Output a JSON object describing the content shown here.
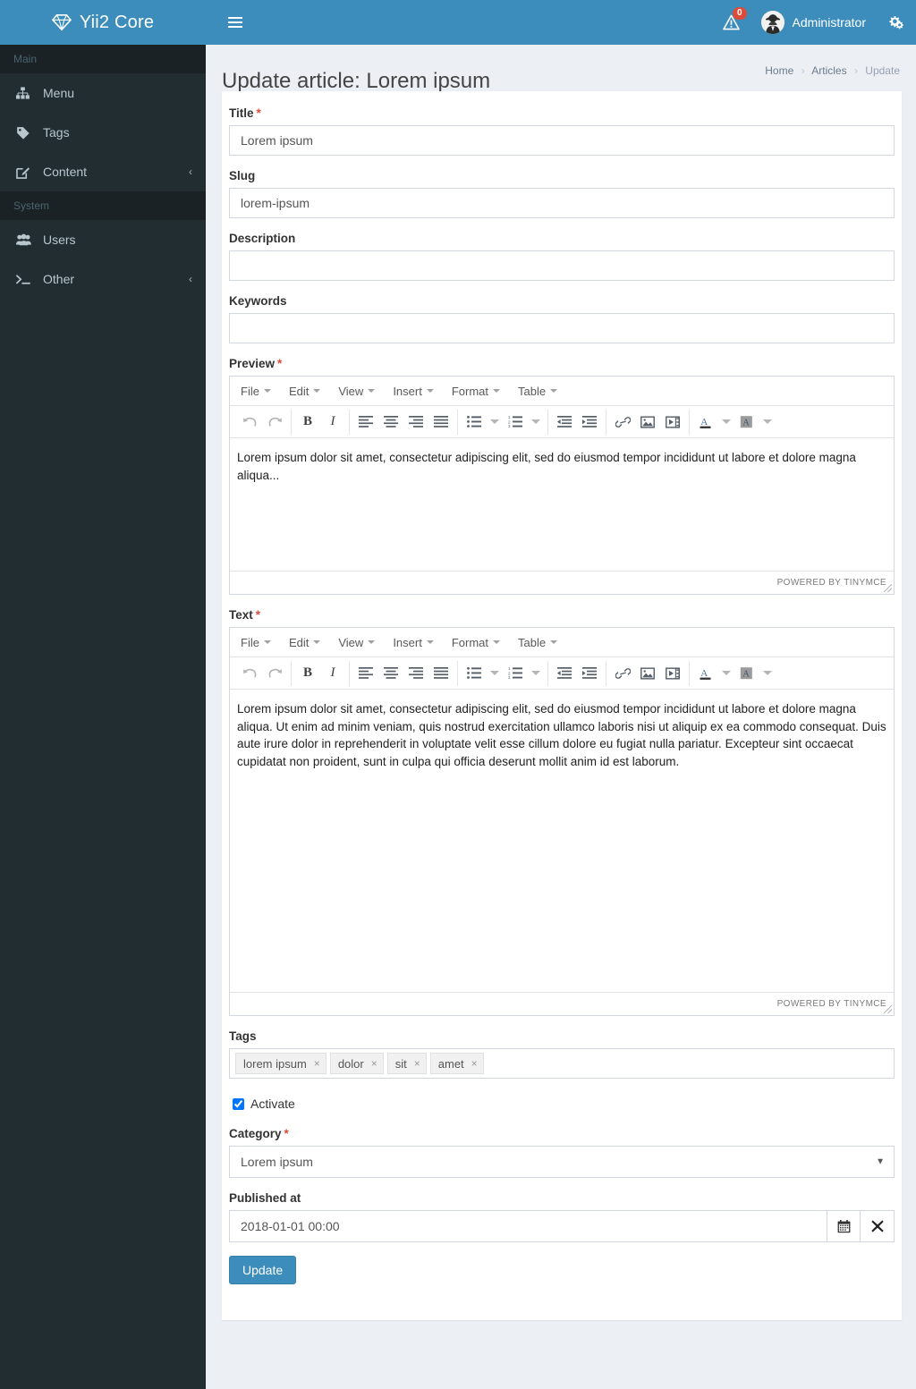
{
  "brand": {
    "name": "Yii2 Core",
    "icon": "gem-icon"
  },
  "header": {
    "menu_toggle_icon": "hamburger-icon",
    "alert_icon": "warning-triangle-icon",
    "alert_count": "0",
    "user_name": "Administrator",
    "avatar_icon": "user-avatar",
    "settings_icon": "gears-icon"
  },
  "sidebar": {
    "sections": [
      {
        "header": "Main",
        "items": [
          {
            "label": "Menu",
            "icon": "sitemap-icon",
            "has_caret": false
          },
          {
            "label": "Tags",
            "icon": "tag-icon",
            "has_caret": false
          },
          {
            "label": "Content",
            "icon": "edit-pencil-icon",
            "has_caret": true,
            "caret": "‹"
          }
        ]
      },
      {
        "header": "System",
        "items": [
          {
            "label": "Users",
            "icon": "users-icon",
            "has_caret": false
          },
          {
            "label": "Other",
            "icon": "terminal-icon",
            "has_caret": true,
            "caret": "‹"
          }
        ]
      }
    ]
  },
  "page": {
    "title": "Update article: Lorem ipsum",
    "breadcrumb": [
      {
        "label": "Home",
        "current": false
      },
      {
        "label": "Articles",
        "current": false
      },
      {
        "label": "Update",
        "current": true
      }
    ],
    "breadcrumb_separator": "›"
  },
  "form": {
    "title_field": {
      "label": "Title",
      "required": true,
      "value": "Lorem ipsum",
      "placeholder": ""
    },
    "slug_field": {
      "label": "Slug",
      "required": false,
      "value": "lorem-ipsum",
      "placeholder": ""
    },
    "description_field": {
      "label": "Description",
      "required": false,
      "value": "",
      "placeholder": ""
    },
    "keywords_field": {
      "label": "Keywords",
      "required": false,
      "value": "",
      "placeholder": ""
    },
    "preview_field": {
      "label": "Preview",
      "required": true,
      "content": "Lorem ipsum dolor sit amet, consectetur adipiscing elit, sed do eiusmod tempor incididunt ut labore et dolore magna aliqua..."
    },
    "text_field": {
      "label": "Text",
      "required": true,
      "content": "Lorem ipsum dolor sit amet, consectetur adipiscing elit, sed do eiusmod tempor incididunt ut labore et dolore magna aliqua. Ut enim ad minim veniam, quis nostrud exercitation ullamco laboris nisi ut aliquip ex ea commodo consequat. Duis aute irure dolor in reprehenderit in voluptate velit esse cillum dolore eu fugiat nulla pariatur. Excepteur sint occaecat cupidatat non proident, sunt in culpa qui officia deserunt mollit anim id est laborum."
    },
    "tags_field": {
      "label": "Tags",
      "tags": [
        "lorem ipsum",
        "dolor",
        "sit",
        "amet"
      ],
      "remove_glyph": "×"
    },
    "activate_checkbox": {
      "label": "Activate",
      "checked": true
    },
    "category_field": {
      "label": "Category",
      "required": true,
      "selected": "Lorem ipsum",
      "options": [
        "Lorem ipsum"
      ],
      "arrow_glyph": "▼"
    },
    "published_field": {
      "label": "Published at",
      "value": "2018-01-01 00:00",
      "placeholder": "",
      "calendar_icon": "calendar-icon",
      "clear_icon": "clear-x-icon"
    },
    "submit_button": {
      "label": "Update"
    }
  },
  "editor": {
    "menubar": [
      "File",
      "Edit",
      "View",
      "Insert",
      "Format",
      "Table"
    ],
    "status_text": "POWERED BY TINYMCE",
    "toolbar_groups": [
      {
        "buttons": [
          {
            "name": "undo-icon"
          },
          {
            "name": "redo-icon"
          }
        ]
      },
      {
        "buttons": [
          {
            "name": "bold-icon"
          },
          {
            "name": "italic-icon"
          }
        ]
      },
      {
        "buttons": [
          {
            "name": "align-left-icon"
          },
          {
            "name": "align-center-icon"
          },
          {
            "name": "align-right-icon"
          },
          {
            "name": "align-justify-icon"
          }
        ]
      },
      {
        "buttons": [
          {
            "name": "bullet-list-icon",
            "caret": true
          },
          {
            "name": "numbered-list-icon",
            "caret": true
          }
        ]
      },
      {
        "buttons": [
          {
            "name": "outdent-icon"
          },
          {
            "name": "indent-icon"
          }
        ]
      },
      {
        "buttons": [
          {
            "name": "link-icon"
          },
          {
            "name": "image-icon"
          },
          {
            "name": "media-icon"
          }
        ]
      },
      {
        "buttons": [
          {
            "name": "text-color-icon",
            "caret": true
          },
          {
            "name": "background-color-icon",
            "caret": true
          }
        ]
      }
    ]
  },
  "colors": {
    "brand_blue": "#3c8dbc",
    "sidebar_dark": "#222d32",
    "sidebar_header_dark": "#1a2226",
    "page_bg": "#ecf0f5",
    "required_red": "#dd4b39",
    "badge_red": "#dd4b39"
  }
}
